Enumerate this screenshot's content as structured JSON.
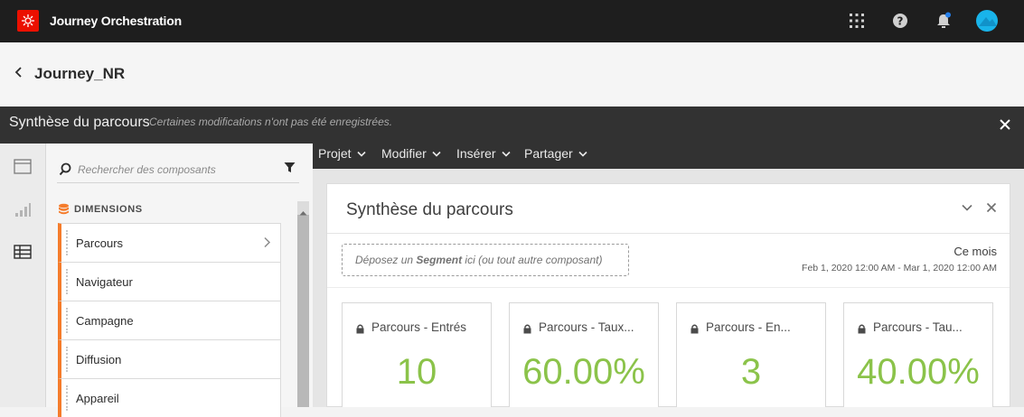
{
  "app": {
    "name": "Journey Orchestration",
    "brand_color": "#eb1000",
    "icons": [
      "apps-grid-icon",
      "help-icon",
      "notifications-icon",
      "avatar"
    ]
  },
  "journey": {
    "title": "Journey_NR"
  },
  "workspace": {
    "title": "Synthèse du parcours",
    "note": "Certaines modifications n'ont pas été enregistrées."
  },
  "components_panel": {
    "search_placeholder": "Rechercher des composants",
    "section_label": "DIMENSIONS",
    "dimensions": [
      {
        "label": "Parcours"
      },
      {
        "label": "Navigateur"
      },
      {
        "label": "Campagne"
      },
      {
        "label": "Diffusion"
      },
      {
        "label": "Appareil"
      }
    ]
  },
  "menu": {
    "items": [
      {
        "label": "Projet"
      },
      {
        "label": "Modifier"
      },
      {
        "label": "Insérer"
      },
      {
        "label": "Partager"
      }
    ]
  },
  "panel": {
    "title": "Synthèse du parcours",
    "dropzone_prefix": "Déposez un ",
    "dropzone_bold": "Segment",
    "dropzone_suffix": " ici (ou tout autre composant)",
    "date_label": "Ce mois",
    "date_range": "Feb 1, 2020 12:00 AM - Mar 1, 2020 12:00 AM"
  },
  "metrics": [
    {
      "title": "Parcours - Entrés",
      "value": "10"
    },
    {
      "title": "Parcours - Taux...",
      "value": "60.00%"
    },
    {
      "title": "Parcours - En...",
      "value": "3"
    },
    {
      "title": "Parcours - Tau...",
      "value": "40.00%"
    }
  ],
  "colors": {
    "accent_orange": "#f57c2b",
    "metric_green": "#8bc34a",
    "avatar_blue": "#19b4ea"
  }
}
